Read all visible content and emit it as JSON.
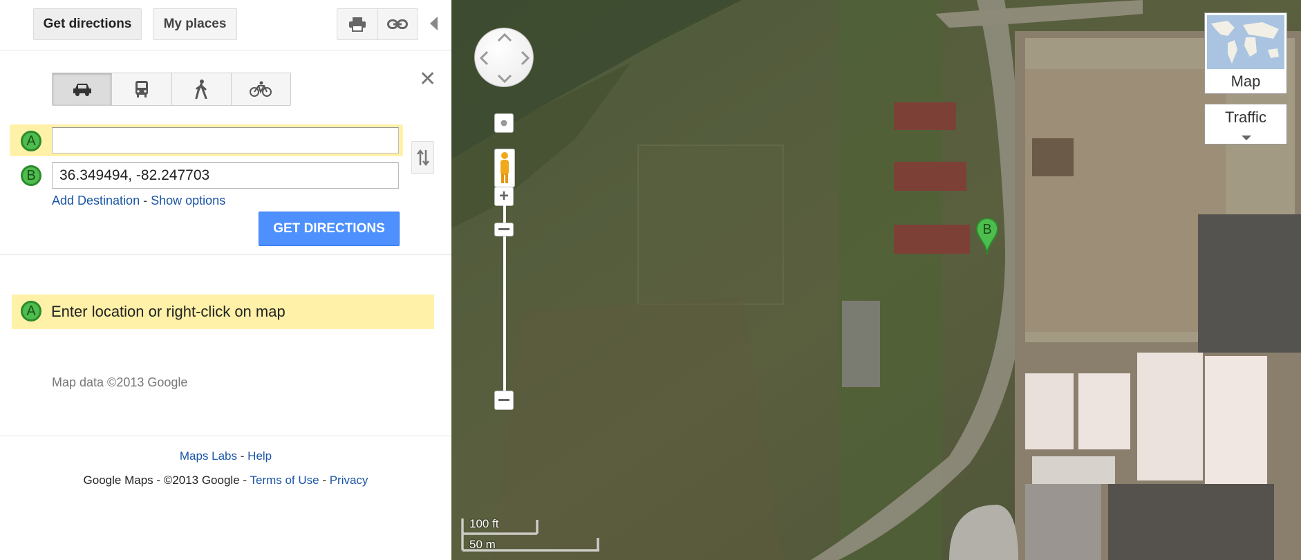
{
  "toolbar": {
    "get_directions": "Get directions",
    "my_places": "My places",
    "print_icon": "printer-icon",
    "link_icon": "link-icon"
  },
  "travel_modes": [
    {
      "name": "car-icon",
      "active": true
    },
    {
      "name": "transit-icon",
      "active": false
    },
    {
      "name": "walking-icon",
      "active": false
    },
    {
      "name": "bicycle-icon",
      "active": false
    }
  ],
  "route": {
    "a_marker": "A",
    "a_value": "",
    "b_marker": "B",
    "b_value": "36.349494, -82.247703"
  },
  "links": {
    "add_destination": "Add Destination",
    "separator": "-",
    "show_options": "Show options"
  },
  "go_button": "GET DIRECTIONS",
  "hint": {
    "marker": "A",
    "text": "Enter location or right-click on map"
  },
  "map_data_text": "Map data ©2013 Google",
  "footer": {
    "labs": "Maps Labs",
    "sep": "-",
    "help": "Help",
    "copyright": "Google Maps - ©2013 Google - ",
    "terms": "Terms of Use",
    "sep2": " - ",
    "privacy": "Privacy"
  },
  "map": {
    "map_type_label": "Map",
    "traffic_label": "Traffic",
    "pin_label": "B",
    "scale_ft": "100 ft",
    "scale_m": "50 m",
    "colors": {
      "accent": "#4d90fe",
      "highlight": "#fff1a8",
      "marker": "#4dbe4d"
    }
  }
}
